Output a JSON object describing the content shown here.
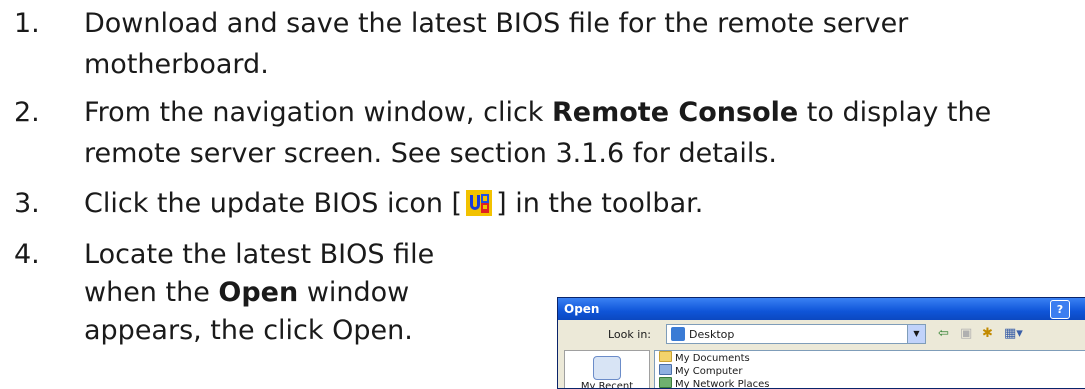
{
  "steps": [
    {
      "num": "1.",
      "line1": "Download and save the latest BIOS file for the remote server",
      "line2": "motherboard."
    },
    {
      "num": "2.",
      "line1_pre": "From the navigation window, click ",
      "line1_em": "Remote Console",
      "line1_post": " to display the",
      "line2": "remote server screen. See section 3.1.6 for details."
    },
    {
      "num": "3.",
      "pre": "Click the update BIOS icon [",
      "post": "] in the toolbar.",
      "icon": "update-bios-icon"
    },
    {
      "num": "4.",
      "line1": "Locate the latest BIOS file",
      "line2_pre": "when the ",
      "line2_em": "Open",
      "line2_post": " window",
      "line3": "appears, the click Open."
    }
  ],
  "dialog": {
    "title": "Open",
    "help": "?",
    "look_in_label": "Look in:",
    "look_in_value": "Desktop",
    "places": [
      "My Recent"
    ],
    "items": [
      "My Documents",
      "My Computer",
      "My Network Places"
    ]
  },
  "colors": {
    "text": "#1a1a1a",
    "titlebar": "#0f55d8",
    "icon_bg": "#f2c200"
  }
}
